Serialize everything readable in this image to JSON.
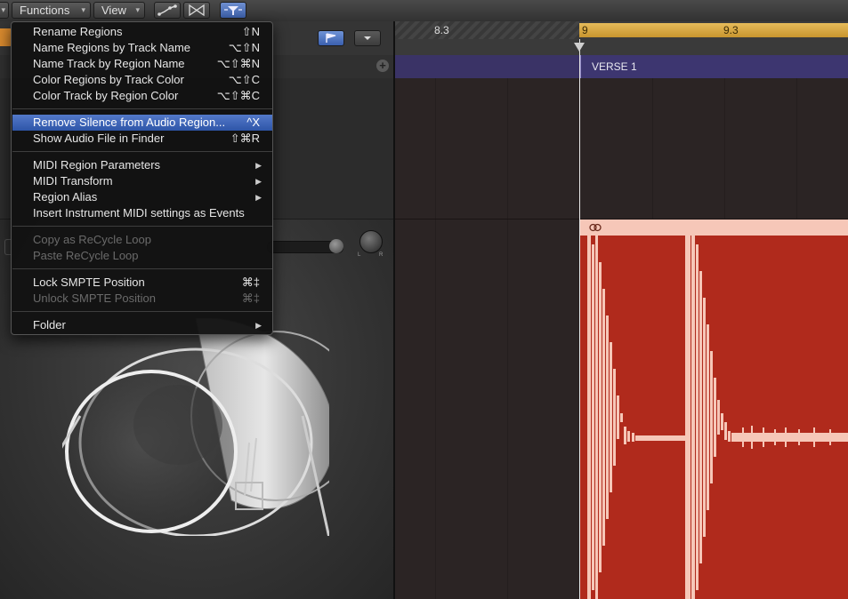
{
  "toolbar": {
    "functions_label": "Functions",
    "view_label": "View",
    "caret": "▾"
  },
  "ruler": {
    "label_1": "8.3",
    "label_2": "9",
    "label_3": "9.3"
  },
  "arrangement": {
    "marker_label": "VERSE 1"
  },
  "menu": {
    "items": [
      {
        "label": "Rename Regions",
        "shortcut": "⇧N"
      },
      {
        "label": "Name Regions by Track Name",
        "shortcut": "⌥⇧N"
      },
      {
        "label": "Name Track by Region Name",
        "shortcut": "⌥⇧⌘N"
      },
      {
        "label": "Color Regions by Track Color",
        "shortcut": "⌥⇧C"
      },
      {
        "label": "Color Track by Region Color",
        "shortcut": "⌥⇧⌘C"
      },
      {
        "label": "Remove Silence from Audio Region...",
        "shortcut": "^X"
      },
      {
        "label": "Show Audio File in Finder",
        "shortcut": "⇧⌘R"
      },
      {
        "label": "MIDI Region Parameters",
        "submenu": "▶"
      },
      {
        "label": "MIDI Transform",
        "submenu": "▶"
      },
      {
        "label": "Region Alias",
        "submenu": "▶"
      },
      {
        "label": "Insert Instrument MIDI settings as Events"
      },
      {
        "label": "Copy as ReCycle Loop"
      },
      {
        "label": "Paste ReCycle Loop"
      },
      {
        "label": "Lock SMPTE Position",
        "shortcut": "⌘‡"
      },
      {
        "label": "Unlock SMPTE Position",
        "shortcut": "⌘‡"
      },
      {
        "label": "Folder",
        "submenu": "▶"
      }
    ]
  },
  "knob": {
    "left": "L",
    "right": "R"
  },
  "colors": {
    "region_body": "#b02a1c",
    "region_waveform": "#f6c7b8",
    "cycle_bar": "#d6a645",
    "highlight": "#3d63b8",
    "arrangement_track": "#3a3366"
  }
}
